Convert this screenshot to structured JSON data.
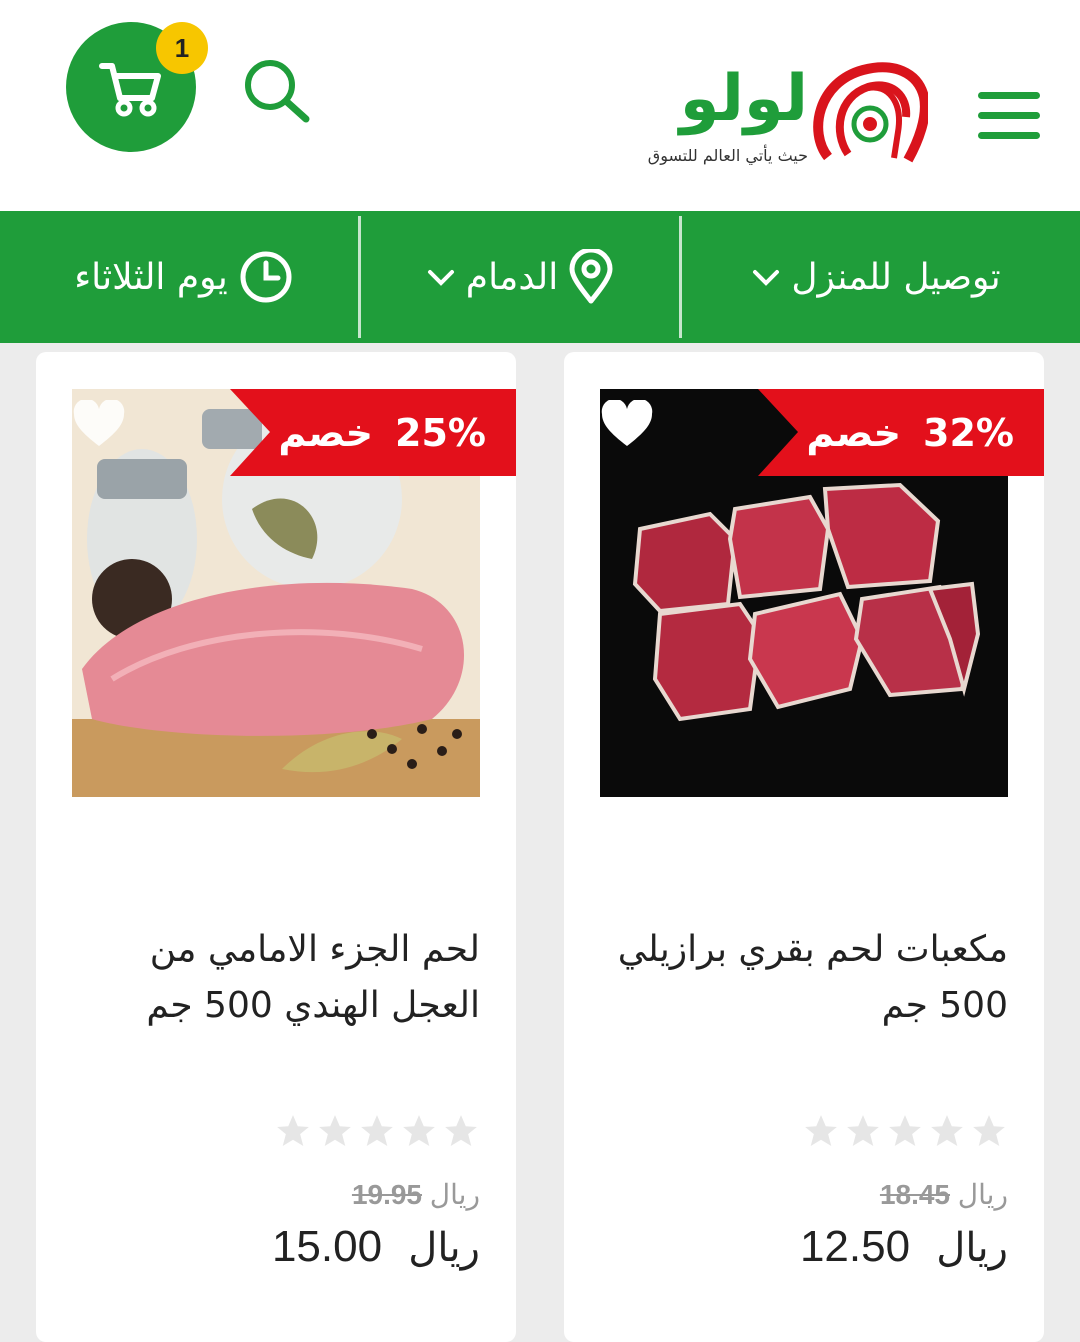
{
  "header": {
    "cart_count": "1",
    "logo_text": "لولو",
    "logo_tagline": "حيث يأتي العالم للتسوق",
    "logo_registered": "®"
  },
  "delivery_bar": {
    "delivery_type": "توصيل للمنزل",
    "city": "الدمام",
    "day": "يوم الثلاثاء"
  },
  "products": [
    {
      "discount_percent": "32%",
      "discount_word": "خصم",
      "title": "مكعبات لحم بقري برازيلي 500 جم",
      "rating": 0,
      "currency": "ريال",
      "old_price": "18.45",
      "new_price": "12.50"
    },
    {
      "discount_percent": "25%",
      "discount_word": "خصم",
      "title": "لحم الجزء الامامي من العجل الهندي 500 جم",
      "rating": 0,
      "currency": "ريال",
      "old_price": "19.95",
      "new_price": "15.00"
    }
  ],
  "colors": {
    "brand_green": "#1f9d3a",
    "badge_yellow": "#f7c600",
    "discount_red": "#e3101b",
    "logo_red": "#d9141c"
  },
  "icons": {
    "cart": "shopping-cart-icon",
    "search": "search-icon",
    "menu": "hamburger-menu-icon",
    "location": "map-pin-icon",
    "clock": "clock-icon",
    "chevron": "chevron-down-icon",
    "heart": "heart-icon",
    "star": "star-icon"
  }
}
